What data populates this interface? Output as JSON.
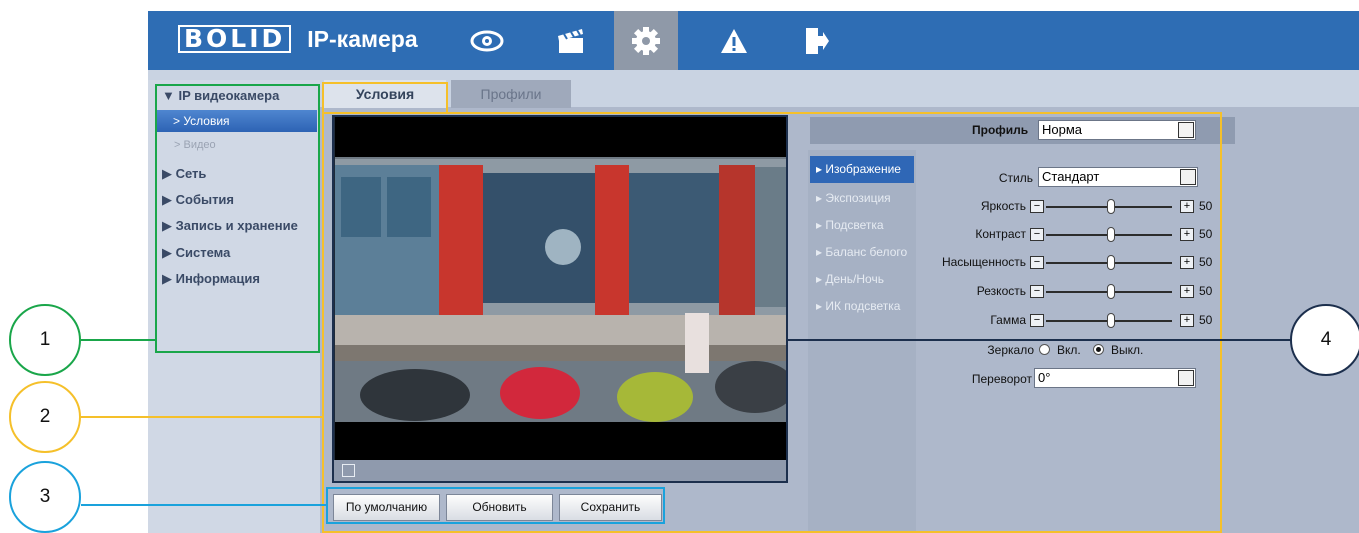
{
  "header": {
    "logo_text": "BOLID",
    "app_title": "IP-камера",
    "icons": [
      "eye-icon",
      "clapperboard-icon",
      "gear-icon",
      "warning-icon",
      "logout-icon"
    ]
  },
  "sidebar": {
    "group_title": "▼ IP видеокамера",
    "active_item": "> Условия",
    "sub_item_video": "> Видео",
    "sections": [
      "▶ Сеть",
      "▶ События",
      "▶ Запись и хранение",
      "▶ Система",
      "▶ Информация"
    ]
  },
  "tabs": {
    "active": "Условия",
    "inactive": "Профили"
  },
  "profile": {
    "label": "Профиль",
    "value": "Норма"
  },
  "settings_menu": {
    "active": "▸ Изображение",
    "items": [
      "▸ Экспозиция",
      "▸ Подсветка",
      "▸ Баланс белого",
      "▸ День/Ночь",
      "▸ ИК подсветка"
    ]
  },
  "image_settings": {
    "style_label": "Стиль",
    "style_value": "Стандарт",
    "sliders": [
      {
        "label": "Яркость",
        "value": "50"
      },
      {
        "label": "Контраст",
        "value": "50"
      },
      {
        "label": "Насыщенность",
        "value": "50"
      },
      {
        "label": "Резкость",
        "value": "50"
      },
      {
        "label": "Гамма",
        "value": "50"
      }
    ],
    "mirror_label": "Зеркало",
    "mirror_on": "Вкл.",
    "mirror_off": "Выкл.",
    "flip_label": "Переворот",
    "flip_value": "0°"
  },
  "buttons": {
    "default": "По умолчанию",
    "refresh": "Обновить",
    "save": "Сохранить"
  },
  "annotations": [
    "1",
    "2",
    "3",
    "4"
  ],
  "colors": {
    "header": "#2e6db4",
    "callout_green": "#1aa64a",
    "callout_yellow": "#f5c02a",
    "callout_cyan": "#1aa2dc",
    "callout_navy": "#1c2f4d"
  }
}
